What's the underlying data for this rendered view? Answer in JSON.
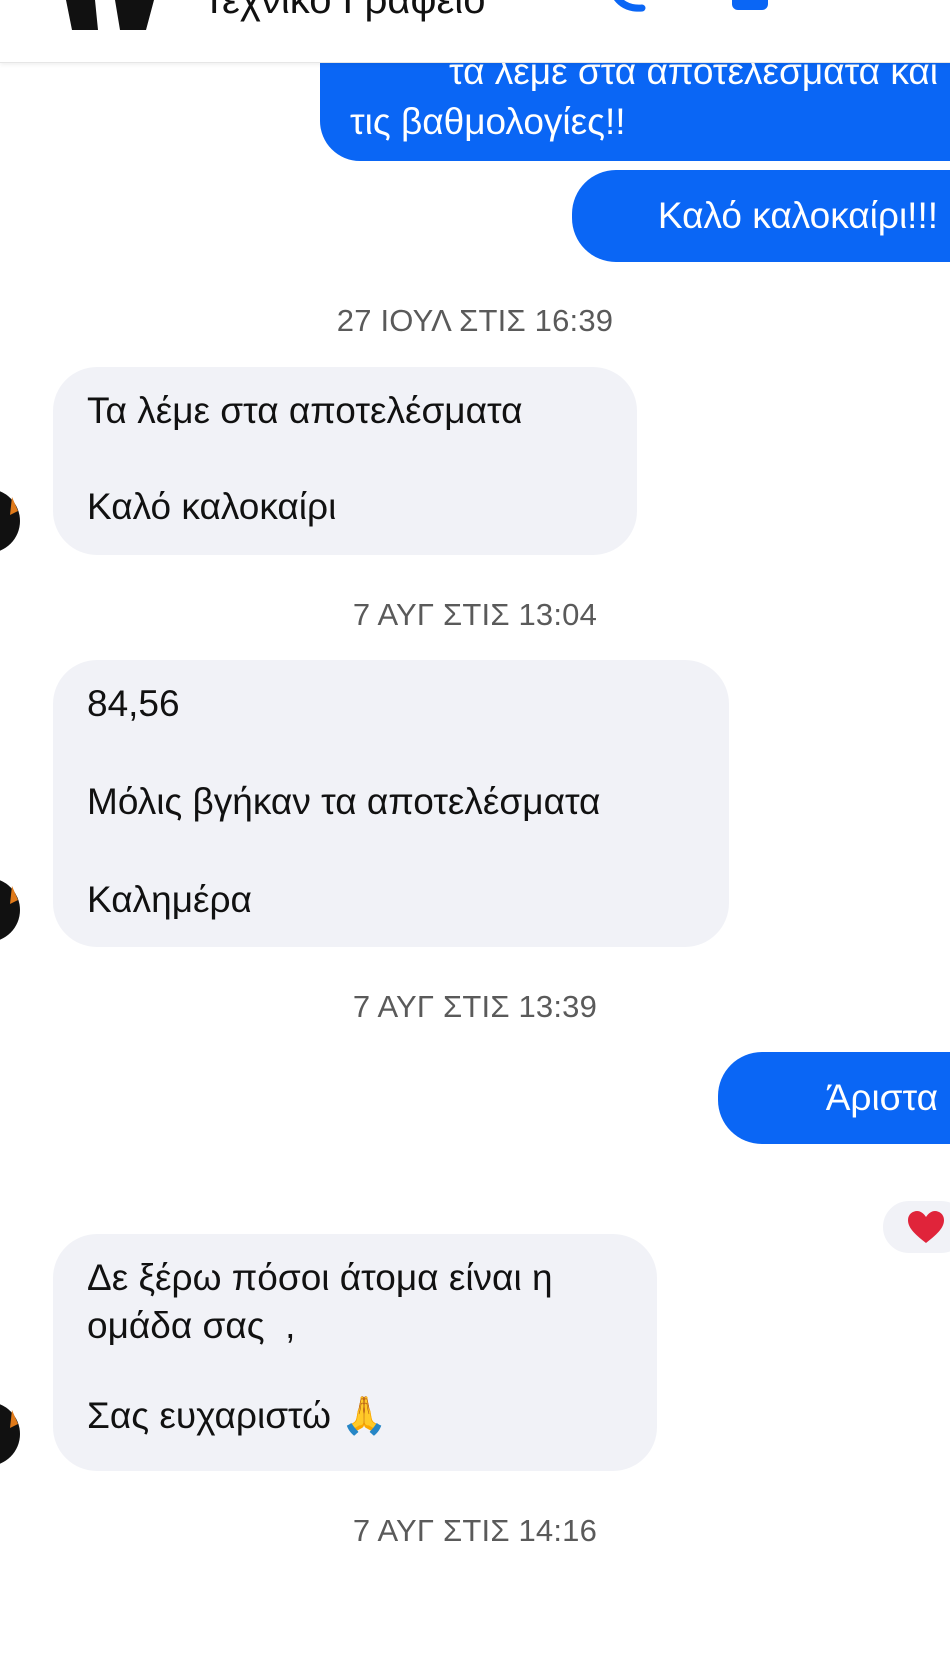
{
  "header": {
    "title": "Τεχνικό Γραφείο"
  },
  "messages": {
    "out_1": [
      "τα λέμε στα αποτελέσματα και",
      "τις βαθμολογίες!!"
    ],
    "out_2": "Καλό καλοκαίρι!!!",
    "ts_1": "27 ΙΟΥΛ ΣΤΙΣ 16:39",
    "in_1": [
      "Τα λέμε στα αποτελέσματα",
      "Καλό καλοκαίρι"
    ],
    "ts_2": "7 ΑΥΓ ΣΤΙΣ 13:04",
    "in_2": [
      "84,56",
      "Μόλις βγήκαν τα αποτελέσματα",
      "Καλημέρα"
    ],
    "ts_3": "7 ΑΥΓ ΣΤΙΣ 13:39",
    "out_3": "Άριστα",
    "out_3_reaction": "heart-icon",
    "in_3": [
      "Δε ξέρω πόσοι άτομα είναι η",
      "ομάδα σας  ,",
      "Σας ευχαριστώ 🙏"
    ],
    "ts_4": "7 ΑΥΓ ΣΤΙΣ 14:16"
  },
  "colors": {
    "outgoing_bubble": "#0a66f5",
    "incoming_bubble": "#f1f2f7",
    "timestamp_text": "#5a5a5a",
    "reaction_heart": "#e0243a"
  }
}
